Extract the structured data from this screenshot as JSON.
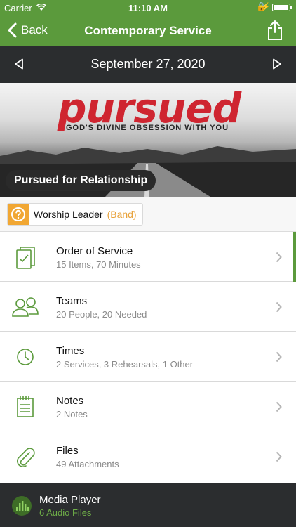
{
  "status": {
    "carrier": "Carrier",
    "time": "11:10 AM"
  },
  "nav": {
    "back_label": "Back",
    "title": "Contemporary Service"
  },
  "datebar": {
    "date": "September 27, 2020"
  },
  "banner": {
    "word": "pursued",
    "tagline": "GOD'S DIVINE OBSESSION WITH YOU",
    "series_title": "Pursued for Relationship"
  },
  "role": {
    "label": "Worship Leader",
    "team": "(Band)"
  },
  "list": [
    {
      "title": "Order of Service",
      "sub": "15 Items, 70 Minutes",
      "icon": "order-of-service-icon"
    },
    {
      "title": "Teams",
      "sub": "20 People, 20 Needed",
      "icon": "teams-icon"
    },
    {
      "title": "Times",
      "sub": "2 Services, 3 Rehearsals, 1 Other",
      "icon": "clock-icon"
    },
    {
      "title": "Notes",
      "sub": "2 Notes",
      "icon": "notes-icon"
    },
    {
      "title": "Files",
      "sub": "49 Attachments",
      "icon": "paperclip-icon"
    }
  ],
  "player": {
    "title": "Media Player",
    "sub": "6 Audio Files"
  },
  "colors": {
    "accent": "#5b9a3c",
    "dark": "#2b2d2f",
    "role": "#f1a733",
    "brand_red": "#cf2530"
  }
}
